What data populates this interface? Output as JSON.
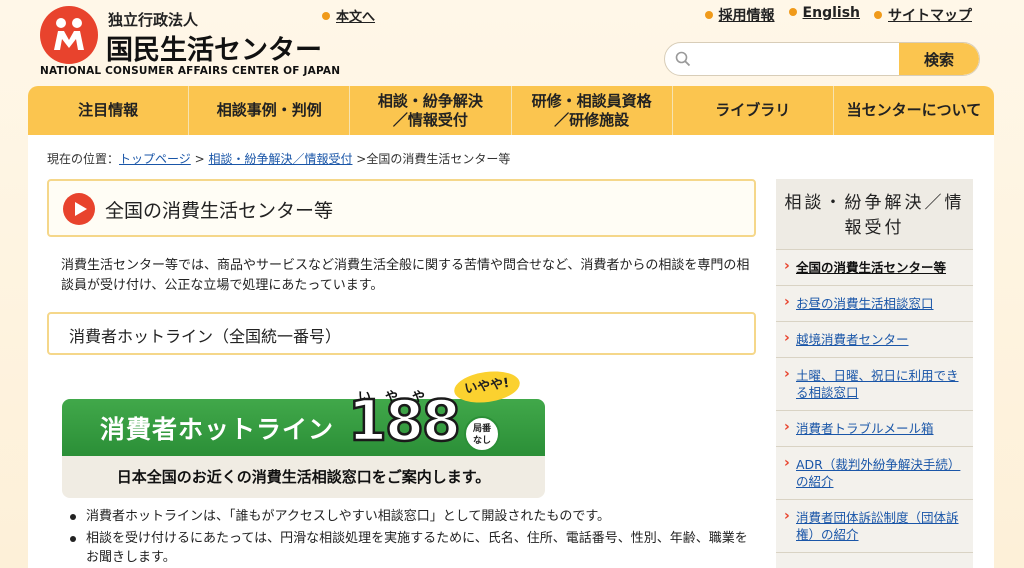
{
  "header": {
    "logo_sub": "独立行政法人",
    "logo_main": "国民生活センター",
    "logo_en": "NATIONAL CONSUMER AFFAIRS CENTER OF JAPAN",
    "skip_link": "本文へ",
    "top_links": [
      "採用情報",
      "English",
      "サイトマップ"
    ],
    "search": {
      "placeholder": "",
      "button": "検索"
    }
  },
  "nav": [
    "注目情報",
    "相談事例・判例",
    "相談・紛争解決\n／情報受付",
    "研修・相談員資格\n／研修施設",
    "ライブラリ",
    "当センターについて"
  ],
  "breadcrumb": {
    "prefix": "現在の位置：",
    "items": [
      "トップページ",
      "相談・紛争解決／情報受付"
    ],
    "current": "全国の消費生活センター等"
  },
  "main": {
    "title": "全国の消費生活センター等",
    "intro": "消費生活センター等では、商品やサービスなど消費生活全般に関する苦情や問合せなど、消費者からの相談を専門の相談員が受け付け、公正な立場で処理にあたっています。",
    "section_title": "消費者ホットライン（全国統一番号）",
    "banner": {
      "name": "消費者ホットライン",
      "number": "188",
      "ruby": "いやや",
      "badge": "局番\nなし",
      "bubble": "いやや!",
      "tagline": "日本全国のお近くの消費生活相談窓口をご案内します。"
    },
    "bullets": [
      "消費者ホットラインは、「誰もがアクセスしやすい相談窓口」として開設されたものです。",
      "相談を受け付けるにあたっては、円滑な相談処理を実施するために、氏名、住所、電話番号、性別、年齢、職業をお聞きします。"
    ]
  },
  "sidebar": {
    "heading": "相談・紛争解決／情報受付",
    "items": [
      "全国の消費生活センター等",
      "お昼の消費生活相談窓口",
      "越境消費者センター",
      "土曜、日曜、祝日に利用できる相談窓口",
      "消費者トラブルメール箱",
      "ADR（裁判外紛争解決手続）の紹介",
      "消費者団体訴訟制度（団体訴権）の紹介"
    ]
  },
  "colors": {
    "accent": "#e8432d",
    "nav": "#fbc54f",
    "link": "#1a56a8",
    "green": "#2b8f37"
  }
}
